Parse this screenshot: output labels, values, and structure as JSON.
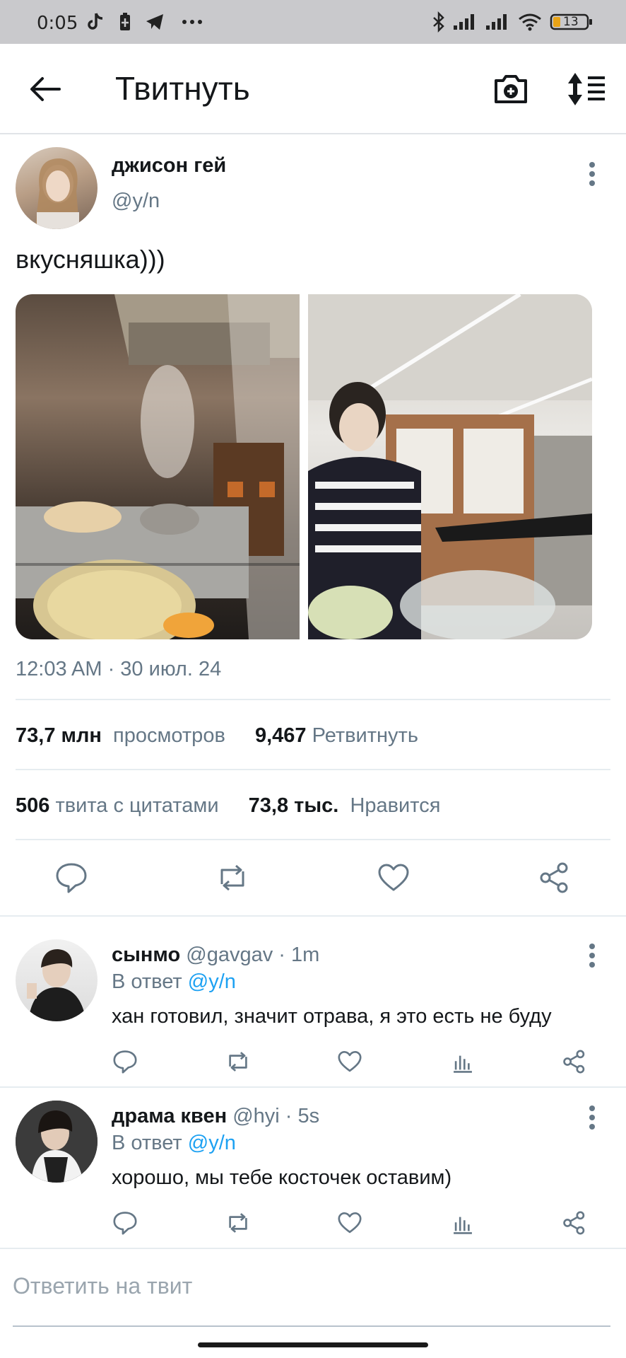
{
  "status_bar": {
    "time": "0:05",
    "battery": "13"
  },
  "app_bar": {
    "title": "Твитнуть"
  },
  "tweet": {
    "author_name": "джисон гей",
    "author_handle": "@y/n",
    "text": "вкусняшка)))",
    "timestamp": "12:03 AM · 30 июл. 24",
    "stats": {
      "views_value": "73,7 млн",
      "views_label": "просмотров",
      "retweets_value": "9,467",
      "retweets_label": "Ретвитнуть",
      "quotes_value": "506",
      "quotes_label": "твита с цитатами",
      "likes_value": "73,8 тыс.",
      "likes_label": "Нравится"
    }
  },
  "replies": [
    {
      "name": "сынмо",
      "meta": "@gavgav · 1m",
      "in_reply_prefix": "В ответ",
      "in_reply_mention": "@y/n",
      "text": "хан готовил, значит отрава, я это есть не буду"
    },
    {
      "name": "драма квен",
      "meta": "@hyi · 5s",
      "in_reply_prefix": "В ответ",
      "in_reply_mention": "@y/n",
      "text": "хорошо, мы тебе косточек оставим)"
    }
  ],
  "compose": {
    "placeholder": "Ответить на твит"
  },
  "colors": {
    "accent": "#1da1f2",
    "secondary_text": "#657786",
    "divider": "#e6ecf0"
  }
}
